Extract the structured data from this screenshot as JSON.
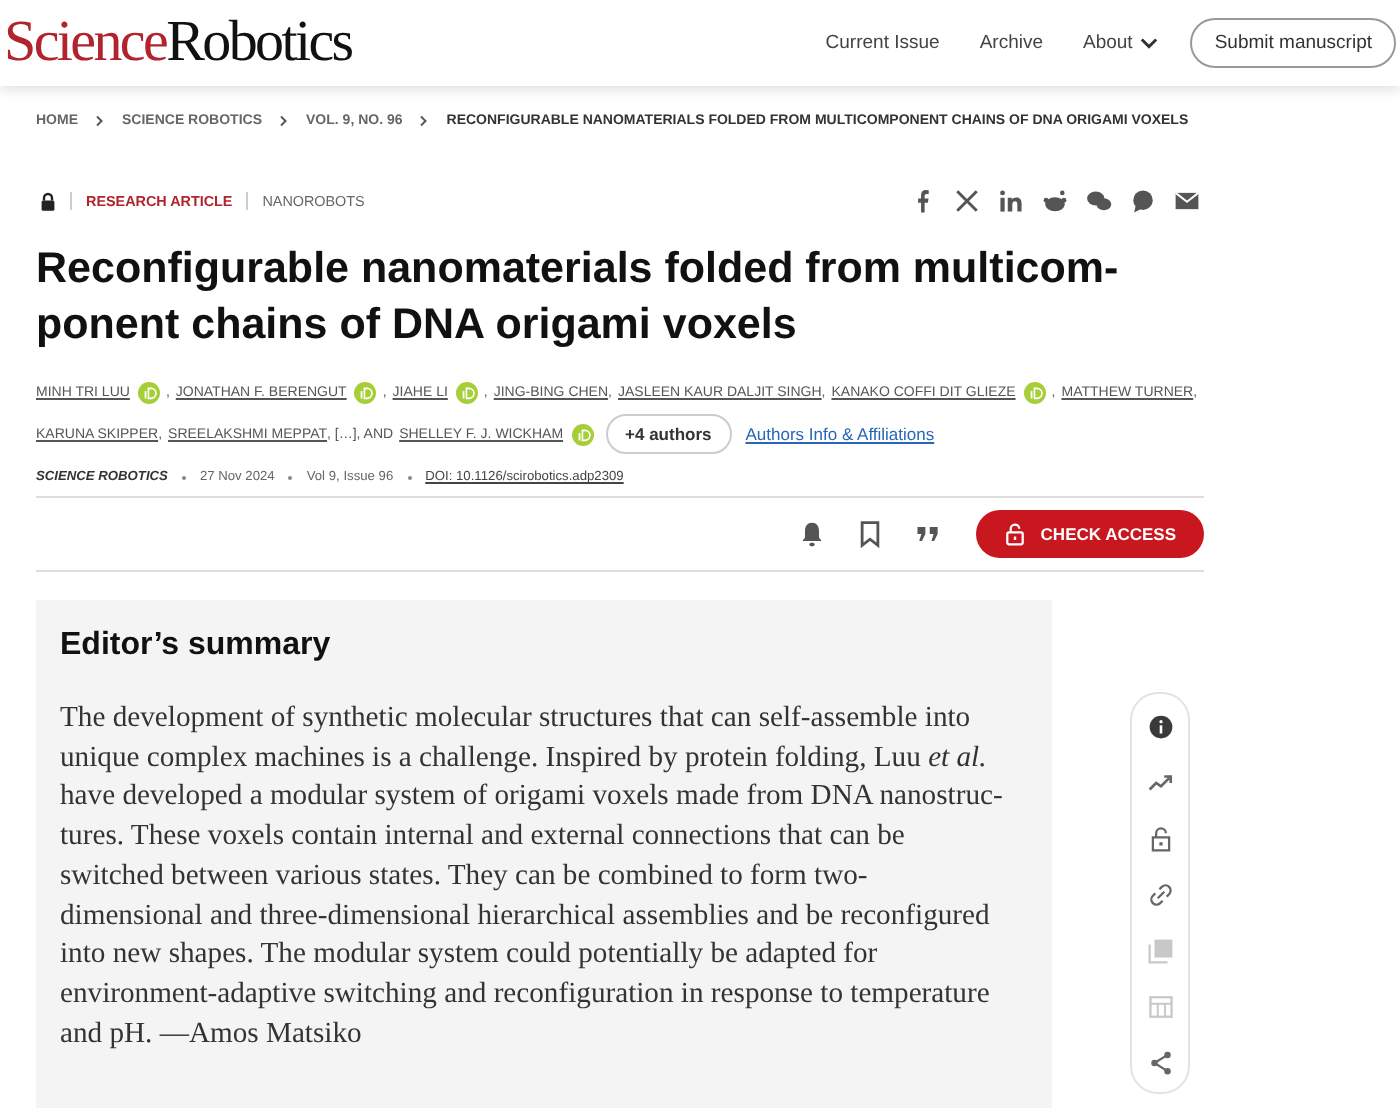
{
  "header": {
    "logo_first": "Science",
    "logo_second": "Robotics",
    "nav": [
      {
        "label": "Current Issue",
        "kind": "link"
      },
      {
        "label": "Archive",
        "kind": "link"
      },
      {
        "label": "About",
        "kind": "dropdown"
      }
    ],
    "submit": "Submit manuscript"
  },
  "breadcrumb": [
    "HOME",
    "SCIENCE ROBOTICS",
    "VOL. 9, NO. 96",
    "RECONFIGURABLE NANOMATERIALS FOLDED FROM MULTICOMPONENT CHAINS OF DNA ORIGAMI VOXELS"
  ],
  "article_type": "RESEARCH ARTICLE",
  "subject": "NANOROBOTS",
  "share": [
    {
      "kind": "facebook"
    },
    {
      "kind": "x"
    },
    {
      "kind": "linkedin"
    },
    {
      "kind": "reddit"
    },
    {
      "kind": "wechat"
    },
    {
      "kind": "whatsapp"
    },
    {
      "kind": "email"
    }
  ],
  "title": "Reconfigurable nanomaterials folded from multicom-ponent chains of DNA origami voxels",
  "authors": [
    {
      "name": "MINH TRI LUU",
      "orcid": true,
      "sep": ","
    },
    {
      "name": "JONATHAN F. BERENGUT",
      "orcid": true,
      "sep": ","
    },
    {
      "name": "JIAHE LI",
      "orcid": true,
      "sep": ","
    },
    {
      "name": "JING-BING CHEN",
      "orcid": false,
      "sep": ","
    },
    {
      "name": "JASLEEN KAUR DALJIT SINGH",
      "orcid": false,
      "sep": ","
    },
    {
      "name": "KANAKO COFFI DIT GLIEZE",
      "orcid": true,
      "sep": ","
    },
    {
      "name": "MATTHEW TURNER",
      "orcid": false,
      "sep": ","
    },
    {
      "name": "KARUNA SKIPPER",
      "orcid": false,
      "sep": ","
    },
    {
      "name": "SREELAKSHMI MEPPAT",
      "orcid": false,
      "sep": ", […], AND"
    },
    {
      "name": "SHELLEY F. J. WICKHAM",
      "orcid": true
    }
  ],
  "more_authors": "+4 authors",
  "affiliations": "Authors Info & Affiliations",
  "meta": {
    "journal": "SCIENCE ROBOTICS",
    "date": "27 Nov 2024",
    "issue": "Vol 9, Issue 96",
    "doi": "DOI: 10.1126/scirobotics.adp2309"
  },
  "actions": [
    {
      "kind": "alert"
    },
    {
      "kind": "bookmark"
    },
    {
      "kind": "cite"
    }
  ],
  "check_access": "CHECK ACCESS",
  "summary": {
    "heading": "Editor’s summary",
    "text": "The development of synthetic molecular structures that can self-assemble into unique complex machines is a challenge. Inspired by protein folding, Luu *et al.* have developed a modular system of origami voxels made from DNA nanostruc-tures. These voxels contain internal and external connections that can be switched between various states. They can be combined to form two-dimensional and three-dimensional hierarchical assemblies and be reconfigured into new shapes. The modular system could potentially be adapted for environment-adaptive switching and reconfiguration in response to temperature and pH. —Amos Matsiko"
  },
  "side_tools": [
    {
      "kind": "info",
      "selected": true,
      "disabled": false
    },
    {
      "kind": "metrics",
      "selected": false,
      "disabled": false
    },
    {
      "kind": "access",
      "selected": false,
      "disabled": false
    },
    {
      "kind": "link",
      "selected": false,
      "disabled": false
    },
    {
      "kind": "figures",
      "selected": false,
      "disabled": true
    },
    {
      "kind": "tables",
      "selected": false,
      "disabled": true
    },
    {
      "kind": "share",
      "selected": false,
      "disabled": false
    }
  ]
}
